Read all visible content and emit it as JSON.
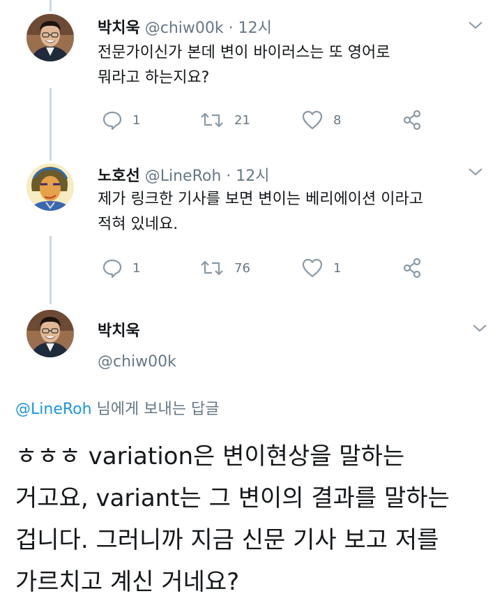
{
  "tweets": [
    {
      "name": "박치욱",
      "handle": "@chiw00k",
      "separator": "·",
      "time": "12시",
      "text_lines": [
        "전문가이신가 본데 변이 바이러스는 또 영어로",
        "뭐라고 하는지요?"
      ],
      "replies": "1",
      "retweets": "21",
      "likes": "8",
      "avatar_icon": "profile-photo"
    },
    {
      "name": "노호선",
      "handle": "@LineRoh",
      "separator": "·",
      "time": "12시",
      "text_lines": [
        "제가 링크한 기사를 보면 변이는 베리에이션 이라고",
        "적혀 있네요."
      ],
      "replies": "1",
      "retweets": "76",
      "likes": "1",
      "avatar_icon": "illustrated-portrait"
    }
  ],
  "main_tweet": {
    "name": "박치욱",
    "handle": "@chiw00k",
    "reply_to_mention": "@LineRoh",
    "reply_to_suffix": " 님에게 보내는 답글",
    "text_lines": [
      "ㅎㅎㅎ variation은 변이현상을 말하는",
      "거고요, variant는 그 변이의 결과를 말하는",
      "겁니다. 그러니까 지금 신문 기사 보고 저를",
      "가르치고 계신 거네요?"
    ]
  },
  "colors": {
    "text": "#14171a",
    "secondary": "#657786",
    "link": "#1b95e0",
    "thread_line": "#ccd6dd",
    "icon": "#8899a6"
  },
  "icons": [
    "reply-icon",
    "retweet-icon",
    "like-icon",
    "share-icon",
    "chevron-down-icon"
  ]
}
